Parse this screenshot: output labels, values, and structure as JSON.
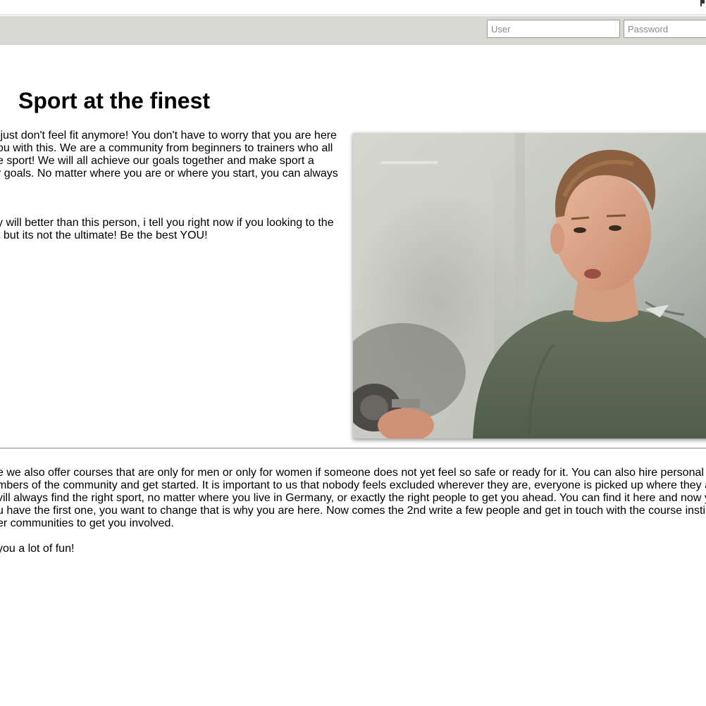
{
  "login": {
    "user_placeholder": "User",
    "password_placeholder": "Password"
  },
  "main": {
    "title": "Sport at the finest",
    "intro_lines": [
      " just don't feel fit anymore! You don't have to worry that you are here",
      "ou with this. We are a community from beginners to trainers who all",
      "e sport! We will all achieve our goals together and make sport a",
      "r goals. No matter where you are or where you start, you can always"
    ],
    "second_lines": [
      "y will better than this person, i tell you right now if you looking to the",
      "t but its not the ultimate! Be the best YOU!"
    ],
    "body_lines": [
      "e we also offer courses that are only for men or only for women if someone does not yet feel so safe or ready for it. You can also hire personal t",
      "mbers of the community and get started. It is important to us that nobody feels excluded wherever they are, everyone is picked up where they a",
      "vill always find the right sport, no matter where you live in Germany, or exactly the right people to get you ahead. You can find it here and now y",
      "u have the first one, you want to change that is why you are here. Now comes the 2nd write a few people and get in touch with the course insti",
      "er communities to get you involved."
    ],
    "closing_line": "you a lot of fun!"
  },
  "hero_image": {
    "description_icon": "trainer-photo",
    "shirt_color": "#5c6a56",
    "background_color": "#c9cac4"
  }
}
